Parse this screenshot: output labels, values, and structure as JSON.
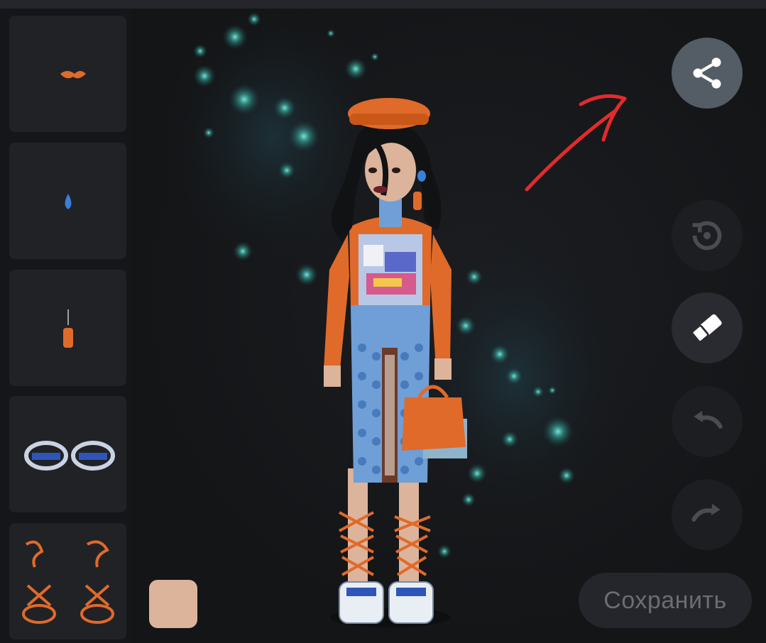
{
  "save_button": {
    "label": "Сохранить"
  },
  "skin_color": "#dcb49b",
  "colors": {
    "background": "#151619",
    "slot_bg": "#212226",
    "share_button_bg": "#545c66",
    "accent_orange": "#e06a2a",
    "annotation_red": "#e42b2b",
    "bokeh": "#3fbfb0"
  },
  "icons": {
    "share": "share-icon",
    "reset": "reset-icon",
    "eraser": "eraser-icon",
    "undo": "undo-icon",
    "redo": "redo-icon"
  },
  "sidebar_slots": [
    {
      "item": "orange-clip-hair-accessory"
    },
    {
      "item": "blue-drop-earring"
    },
    {
      "item": "orange-dangle-earring"
    },
    {
      "item": "blue-silver-bracelets"
    },
    {
      "item": "orange-lace-up-sandals"
    }
  ]
}
